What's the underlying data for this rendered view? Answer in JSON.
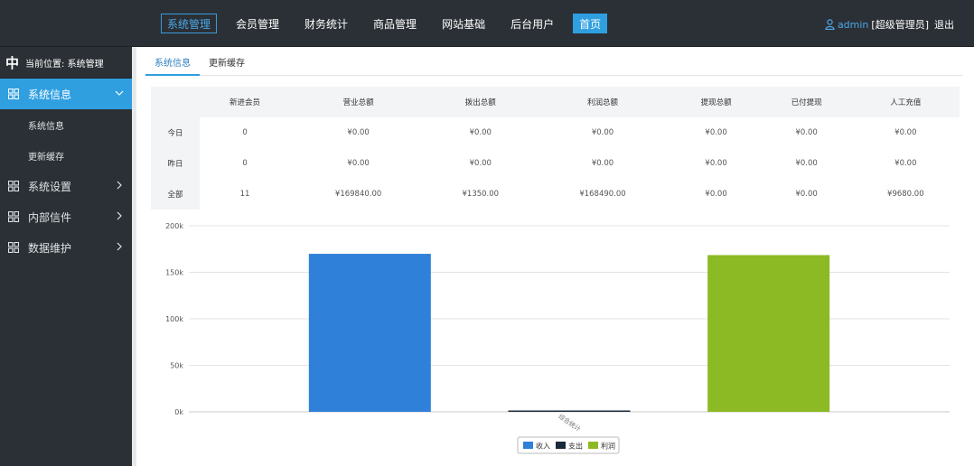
{
  "topnav": {
    "items": [
      "系统管理",
      "会员管理",
      "财务统计",
      "商品管理",
      "网站基础",
      "后台用户",
      "首页"
    ],
    "user": "admin",
    "role": "[超级管理员]",
    "logout": "退出"
  },
  "sidebar": {
    "location": "当前位置: 系统管理",
    "menu": [
      {
        "label": "系统信息",
        "open": true,
        "children": [
          "系统信息",
          "更新缓存"
        ]
      },
      {
        "label": "系统设置"
      },
      {
        "label": "内部信件"
      },
      {
        "label": "数据维护"
      }
    ]
  },
  "tabs": [
    "系统信息",
    "更新缓存"
  ],
  "stats": {
    "headers": [
      "",
      "新进会员",
      "营业总额",
      "拨出总额",
      "利润总额",
      "提现总额",
      "已付提现",
      "人工充值"
    ],
    "rows": [
      [
        "今日",
        "0",
        "¥0.00",
        "¥0.00",
        "¥0.00",
        "¥0.00",
        "¥0.00",
        "¥0.00"
      ],
      [
        "昨日",
        "0",
        "¥0.00",
        "¥0.00",
        "¥0.00",
        "¥0.00",
        "¥0.00",
        "¥0.00"
      ],
      [
        "全部",
        "11",
        "¥169840.00",
        "¥1350.00",
        "¥168490.00",
        "¥0.00",
        "¥0.00",
        "¥9680.00"
      ]
    ]
  },
  "chart_data": {
    "type": "bar",
    "categories": [
      "综合统计"
    ],
    "series": [
      {
        "name": "收入",
        "values": [
          169840
        ],
        "color": "#2f80d8"
      },
      {
        "name": "支出",
        "values": [
          1350
        ],
        "color": "#1b2a3a"
      },
      {
        "name": "利润",
        "values": [
          168490
        ],
        "color": "#8cba24"
      }
    ],
    "ylim": [
      0,
      200000
    ],
    "yticks": [
      "0k",
      "50k",
      "100k",
      "150k",
      "200k"
    ],
    "grid": true,
    "legend": "bottom"
  },
  "colors": {
    "topbar": "#2b3036",
    "accent": "#2f9fe0"
  }
}
